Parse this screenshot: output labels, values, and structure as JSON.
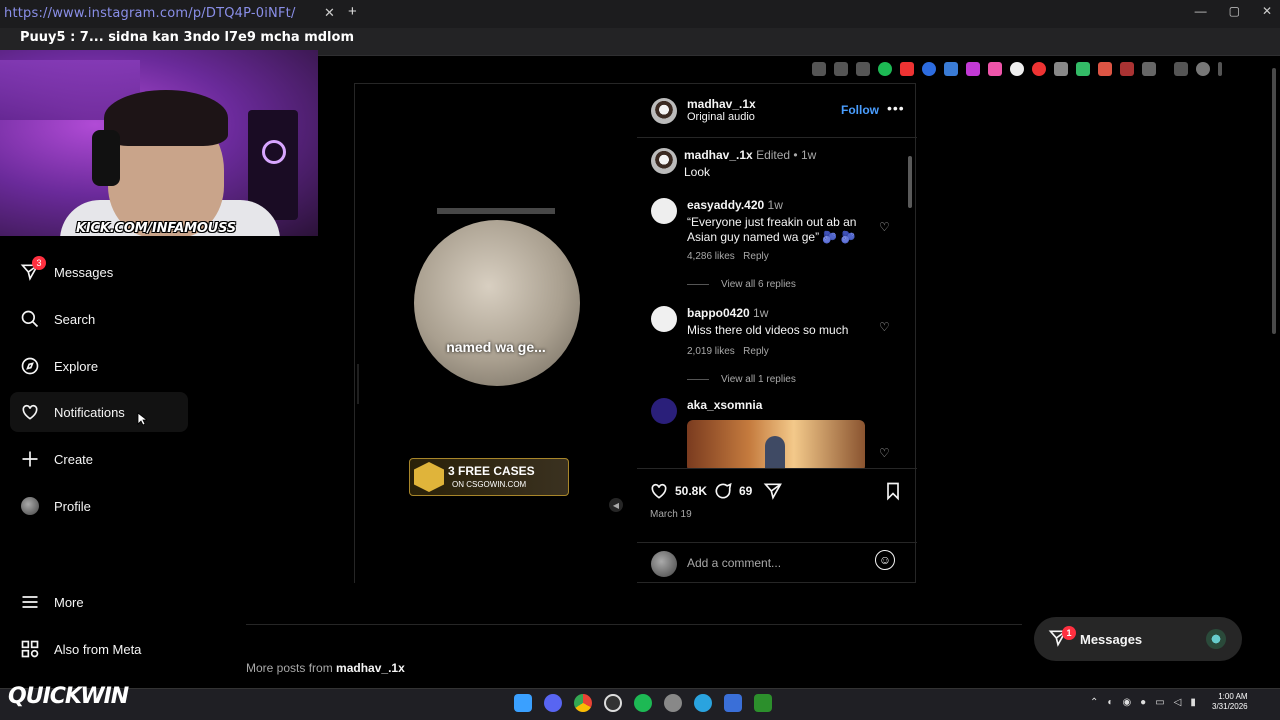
{
  "browser": {
    "url_overlay": "https://www.instagram.com/p/DTQ4P-0iNFt/",
    "tab_close": "✕",
    "new_tab": "+",
    "window_controls": [
      "—",
      "▢",
      "✕"
    ]
  },
  "stream": {
    "ticker": "Puuy5 : 7... sidna kan 3ndo l7e9 mcha mdlom",
    "kick_url": "KICK.COM/INFAMOUSS",
    "watermark_part1": "QUICK",
    "watermark_part2": "WIN"
  },
  "sidebar": {
    "items": [
      {
        "label": "Messages",
        "icon": "messenger-icon",
        "badge": "3"
      },
      {
        "label": "Search",
        "icon": "search-icon"
      },
      {
        "label": "Explore",
        "icon": "compass-icon"
      },
      {
        "label": "Notifications",
        "icon": "heart-icon"
      },
      {
        "label": "Create",
        "icon": "plus-icon"
      },
      {
        "label": "Profile",
        "icon": "avatar-icon"
      },
      {
        "label": "More",
        "icon": "hamburger-icon"
      },
      {
        "label": "Also from Meta",
        "icon": "meta-apps-icon"
      }
    ]
  },
  "post": {
    "video_caption": "named wa ge...",
    "ad": {
      "line1": "3 FREE CASES",
      "line2": "ON CSGOWIN.COM"
    },
    "author": "madhav_.1x",
    "audio": "Original audio",
    "follow_label": "Follow",
    "menu_label": "•••",
    "caption": {
      "user": "madhav_.1x",
      "meta": "Edited •",
      "time": "1w",
      "text": "Look"
    },
    "comments": [
      {
        "user": "easyaddy.420",
        "time": "1w",
        "text": "“Everyone just freakin out ab an Asian guy named wa ge” 🫐 🫐",
        "likes": "4,286 likes",
        "reply": "Reply",
        "view_replies": "View all 6 replies"
      },
      {
        "user": "bappo0420",
        "time": "1w",
        "text": "Miss there old videos so much",
        "likes": "2,019 likes",
        "reply": "Reply",
        "view_replies": "View all 1 replies"
      },
      {
        "user": "aka_xsomnia"
      }
    ],
    "like_count": "50.8K",
    "comment_count": "69",
    "date": "March 19",
    "add_comment_placeholder": "Add a comment...",
    "emoji_icon": "☺"
  },
  "footer": {
    "more_posts_prefix": "More posts from",
    "more_posts_user": "madhav_.1x"
  },
  "messages_pill": {
    "label": "Messages",
    "badge": "1"
  },
  "taskbar": {
    "clock_time": "1:00 AM",
    "clock_date": "3/31/2026"
  }
}
